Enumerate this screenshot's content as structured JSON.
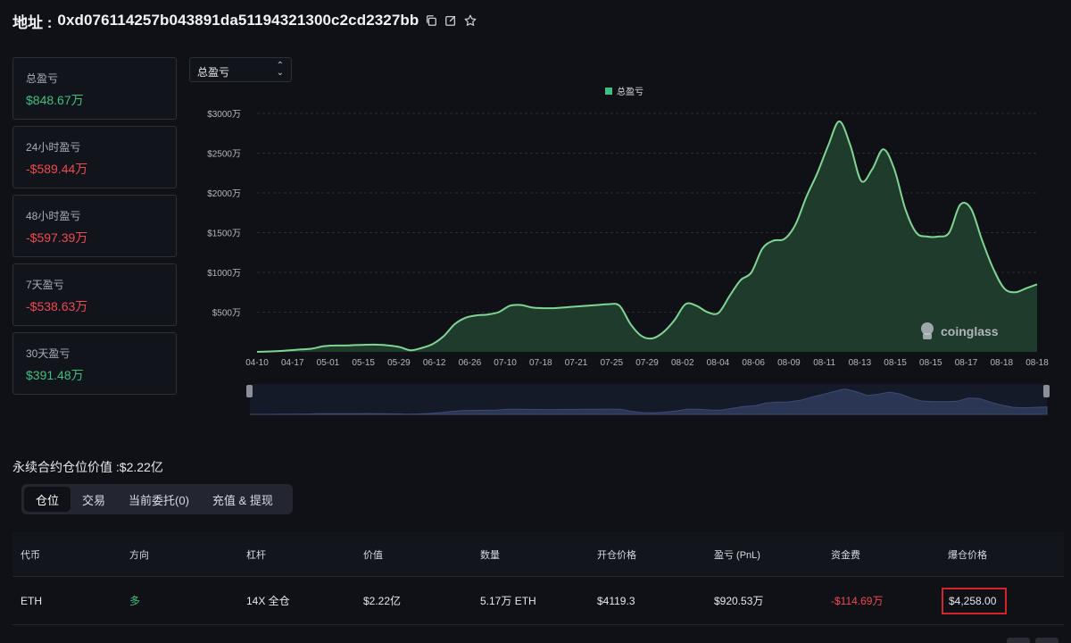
{
  "header": {
    "label": "地址 :",
    "address": "0xd076114257b043891da51194321300c2cd2327bb",
    "icons": [
      "copy-icon",
      "edit-icon",
      "star-icon"
    ]
  },
  "stats": [
    {
      "label": "总盈亏",
      "value": "$848.67万",
      "tone": "pos"
    },
    {
      "label": "24小时盈亏",
      "value": "-$589.44万",
      "tone": "neg"
    },
    {
      "label": "48小时盈亏",
      "value": "-$597.39万",
      "tone": "neg"
    },
    {
      "label": "7天盈亏",
      "value": "-$538.63万",
      "tone": "neg"
    },
    {
      "label": "30天盈亏",
      "value": "$391.48万",
      "tone": "pos"
    }
  ],
  "selector": {
    "value": "总盈亏"
  },
  "chart_data": {
    "type": "area",
    "legend": "总盈亏",
    "legend_position": "top-center",
    "watermark": "coinglass",
    "y_ticks": [
      "$500万",
      "$1000万",
      "$1500万",
      "$2000万",
      "$2500万",
      "$3000万"
    ],
    "ylim": [
      0,
      3000
    ],
    "x_ticks": [
      "04-10",
      "04-17",
      "05-01",
      "05-15",
      "05-29",
      "06-12",
      "06-26",
      "07-10",
      "07-18",
      "07-21",
      "07-25",
      "07-29",
      "08-02",
      "08-04",
      "08-06",
      "08-09",
      "08-11",
      "08-13",
      "08-15",
      "08-15",
      "08-17",
      "08-18",
      "08-18"
    ],
    "series": [
      {
        "values": [
          0,
          5,
          10,
          20,
          30,
          40,
          70,
          80,
          80,
          85,
          90,
          90,
          80,
          60,
          20,
          50,
          100,
          200,
          350,
          430,
          460,
          470,
          500,
          580,
          590,
          560,
          550,
          550,
          560,
          570,
          580,
          590,
          600,
          580,
          350,
          200,
          170,
          250,
          400,
          600,
          580,
          500,
          490,
          700,
          900,
          1000,
          1300,
          1400,
          1420,
          1600,
          1950,
          2250,
          2600,
          2900,
          2600,
          2150,
          2300,
          2550,
          2300,
          1800,
          1500,
          1450,
          1450,
          1500,
          1850,
          1800,
          1400,
          1050,
          800,
          750,
          800,
          850
        ]
      }
    ],
    "grid": true,
    "navigator": true,
    "fill_color": "#1f3b2c",
    "line_color": "#7fd693"
  },
  "section": {
    "title": "永续合约仓位价值 :$2.22亿"
  },
  "tabs": [
    {
      "label": "仓位",
      "active": true
    },
    {
      "label": "交易",
      "active": false
    },
    {
      "label": "当前委托(0)",
      "active": false
    },
    {
      "label": "充值 & 提现",
      "active": false
    }
  ],
  "table": {
    "headers": [
      "代币",
      "方向",
      "杠杆",
      "价值",
      "数量",
      "开仓价格",
      "盈亏 (PnL)",
      "资金费",
      "爆仓价格"
    ],
    "row": {
      "token": "ETH",
      "direction": "多",
      "leverage": "14X 全仓",
      "value": "$2.22亿",
      "amount": "5.17万 ETH",
      "entry": "$4119.3",
      "pnl": "$920.53万",
      "funding": "-$114.69万",
      "liq": "$4,258.00"
    }
  },
  "colors": {
    "positive": "#3fbf7f",
    "negative": "#f0494f",
    "highlight_box": "#d5232a"
  }
}
